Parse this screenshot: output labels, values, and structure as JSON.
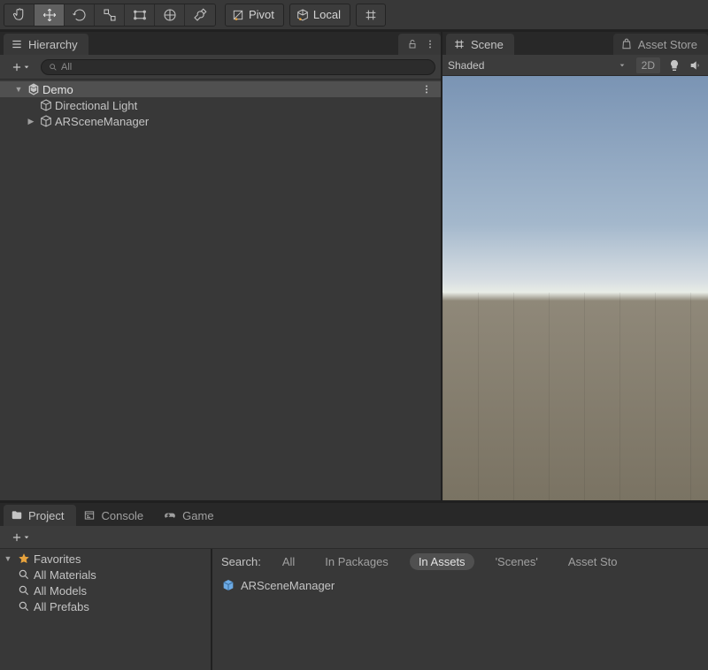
{
  "toolbar": {
    "pivot_label": "Pivot",
    "local_label": "Local"
  },
  "hierarchy": {
    "tab_label": "Hierarchy",
    "search_placeholder": "All",
    "scene_name": "Demo",
    "items": [
      {
        "label": "Directional Light",
        "expandable": false
      },
      {
        "label": "ARSceneManager",
        "expandable": true
      }
    ]
  },
  "scene": {
    "tab_scene": "Scene",
    "tab_asset_store": "Asset Store",
    "shading_mode": "Shaded",
    "btn_2d": "2D"
  },
  "project": {
    "tab_project": "Project",
    "tab_console": "Console",
    "tab_game": "Game",
    "favorites_header": "Favorites",
    "favorites": [
      "All Materials",
      "All Models",
      "All Prefabs"
    ],
    "search_label": "Search:",
    "filters": {
      "all": "All",
      "in_packages": "In Packages",
      "in_assets": "In Assets",
      "scenes": "'Scenes'",
      "asset_store": "Asset Sto"
    },
    "asset_name": "ARSceneManager"
  }
}
